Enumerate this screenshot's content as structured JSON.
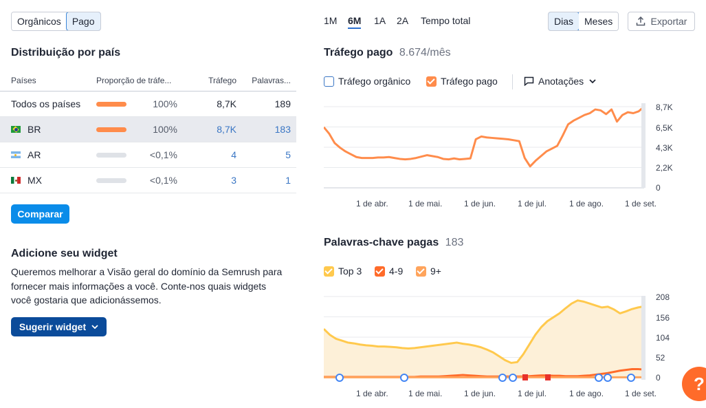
{
  "source_toggle": {
    "organic": "Orgânicos",
    "paid": "Pago"
  },
  "distribution": {
    "title": "Distribuição por país",
    "columns": [
      "Países",
      "Proporção de tráfe...",
      "Tráfego",
      "Palavras..."
    ],
    "rows": [
      {
        "country": "Todos os países",
        "share": "100%",
        "share_value": 1.0,
        "traffic": "8,7K",
        "keywords": "189"
      },
      {
        "country": "BR",
        "share": "100%",
        "share_value": 1.0,
        "traffic": "8,7K",
        "keywords": "183"
      },
      {
        "country": "AR",
        "share": "<0,1%",
        "share_value": 0.0,
        "traffic": "4",
        "keywords": "5"
      },
      {
        "country": "MX",
        "share": "<0,1%",
        "share_value": 0.0,
        "traffic": "3",
        "keywords": "1"
      }
    ],
    "compare_label": "Comparar"
  },
  "widget": {
    "title": "Adicione seu widget",
    "text": "Queremos melhorar a Visão geral do domínio da Semrush para fornecer mais informações a você. Conte-nos quais widgets você gostaria que adicionássemos.",
    "button": "Sugerir widget"
  },
  "periods": [
    "1M",
    "6M",
    "1A",
    "2A",
    "Tempo total"
  ],
  "granularity": {
    "days": "Dias",
    "months": "Meses"
  },
  "export_label": "Exportar",
  "traffic_chart": {
    "title": "Tráfego pago",
    "value": "8.674/mês",
    "legend": {
      "organic": "Tráfego orgânico",
      "paid": "Tráfego pago",
      "annotations": "Anotações"
    }
  },
  "keywords_chart": {
    "title": "Palavras-chave pagas",
    "value": "183",
    "legend": {
      "top3": "Top 3",
      "r49": "4-9",
      "r9plus": "9+"
    }
  },
  "colors": {
    "paid": "#ff8c4b",
    "top3": "#ffc94d",
    "r49": "#ff6b2a",
    "r9plus": "#ffa45c",
    "accent": "#0a8ce9"
  },
  "chart_data": [
    {
      "type": "line",
      "title": "Tráfego pago",
      "x_ticks": [
        "1 de abr.",
        "1 de mai.",
        "1 de jun.",
        "1 de jul.",
        "1 de ago.",
        "1 de set."
      ],
      "y_ticks": [
        "8,7K",
        "6,5K",
        "4,3K",
        "2,2K",
        "0"
      ],
      "ylim": [
        0,
        8700
      ],
      "series": [
        {
          "name": "Tráfego pago",
          "values": [
            6500,
            5800,
            4800,
            4300,
            3900,
            3600,
            3300,
            3200,
            3200,
            3200,
            3250,
            3250,
            3300,
            3200,
            3100,
            3050,
            3100,
            3200,
            3350,
            3500,
            3400,
            3300,
            3100,
            3050,
            3150,
            3050,
            3100,
            3150,
            5200,
            5500,
            5400,
            5350,
            5300,
            5250,
            5200,
            5100,
            5000,
            3200,
            2300,
            2900,
            3400,
            3900,
            4200,
            4500,
            5600,
            6800,
            7200,
            7500,
            7800,
            8000,
            8400,
            8300,
            7900,
            8400,
            7100,
            7800,
            8100,
            8000,
            8200,
            8700
          ]
        }
      ]
    },
    {
      "type": "area",
      "title": "Palavras-chave pagas",
      "x_ticks": [
        "1 de abr.",
        "1 de mai.",
        "1 de jun.",
        "1 de jul.",
        "1 de ago.",
        "1 de set."
      ],
      "y_ticks": [
        "208",
        "156",
        "104",
        "52",
        "0"
      ],
      "ylim": [
        0,
        208
      ],
      "series": [
        {
          "name": "Top 3",
          "values": [
            125,
            110,
            100,
            95,
            90,
            88,
            85,
            83,
            82,
            80,
            80,
            79,
            78,
            76,
            75,
            76,
            78,
            80,
            82,
            84,
            86,
            88,
            90,
            87,
            85,
            82,
            78,
            72,
            65,
            55,
            45,
            38,
            40,
            60,
            85,
            110,
            130,
            145,
            155,
            165,
            178,
            190,
            198,
            195,
            190,
            185,
            180,
            182,
            175,
            165,
            170,
            176,
            180,
            183
          ]
        },
        {
          "name": "4-9",
          "values": [
            2,
            2,
            2,
            2,
            2,
            2,
            2,
            2,
            2,
            2,
            2,
            2,
            2,
            2,
            2,
            2,
            3,
            3,
            3,
            3,
            4,
            5,
            6,
            7,
            6,
            5,
            4,
            3,
            3,
            3,
            3,
            3,
            3,
            3,
            4,
            5,
            6,
            6,
            5,
            5,
            4,
            4,
            4,
            5,
            6,
            8,
            10,
            12,
            15,
            18,
            20,
            22,
            22,
            21
          ]
        },
        {
          "name": "9+",
          "values": [
            1,
            1,
            1,
            1,
            1,
            1,
            1,
            1,
            1,
            1,
            1,
            1,
            1,
            1,
            1,
            1,
            1,
            1,
            1,
            1,
            1,
            1,
            1,
            1,
            1,
            1,
            1,
            1,
            1,
            1,
            1,
            1,
            1,
            1,
            1,
            1,
            1,
            1,
            1,
            1,
            1,
            1,
            1,
            1,
            1,
            1,
            1,
            1,
            1,
            1,
            1,
            1,
            1,
            1
          ]
        }
      ]
    }
  ],
  "help_label": "?"
}
